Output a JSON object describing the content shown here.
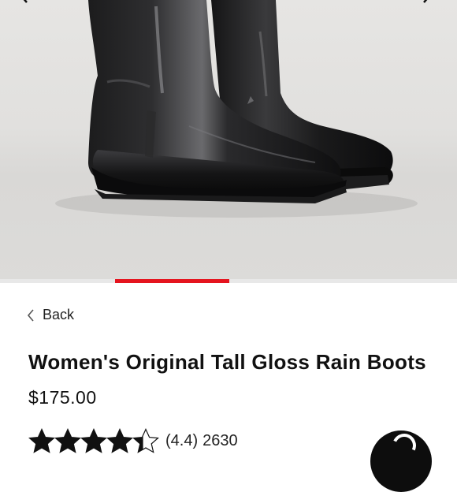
{
  "product": {
    "title": "Women's Original Tall Gloss Rain Boots",
    "price": "$175.00",
    "rating": {
      "value": 4.4,
      "max": 5,
      "label": "(4.4)",
      "review_count": "2630"
    }
  },
  "navigation": {
    "back_label": "Back"
  },
  "gallery": {
    "progress_fraction": 0.25,
    "accent_color": "#e5141e"
  },
  "icons": {
    "back": "chevron-left-icon",
    "prev": "chevron-left-icon",
    "next": "chevron-right-icon",
    "star": "star-icon",
    "fab": "help-icon"
  }
}
